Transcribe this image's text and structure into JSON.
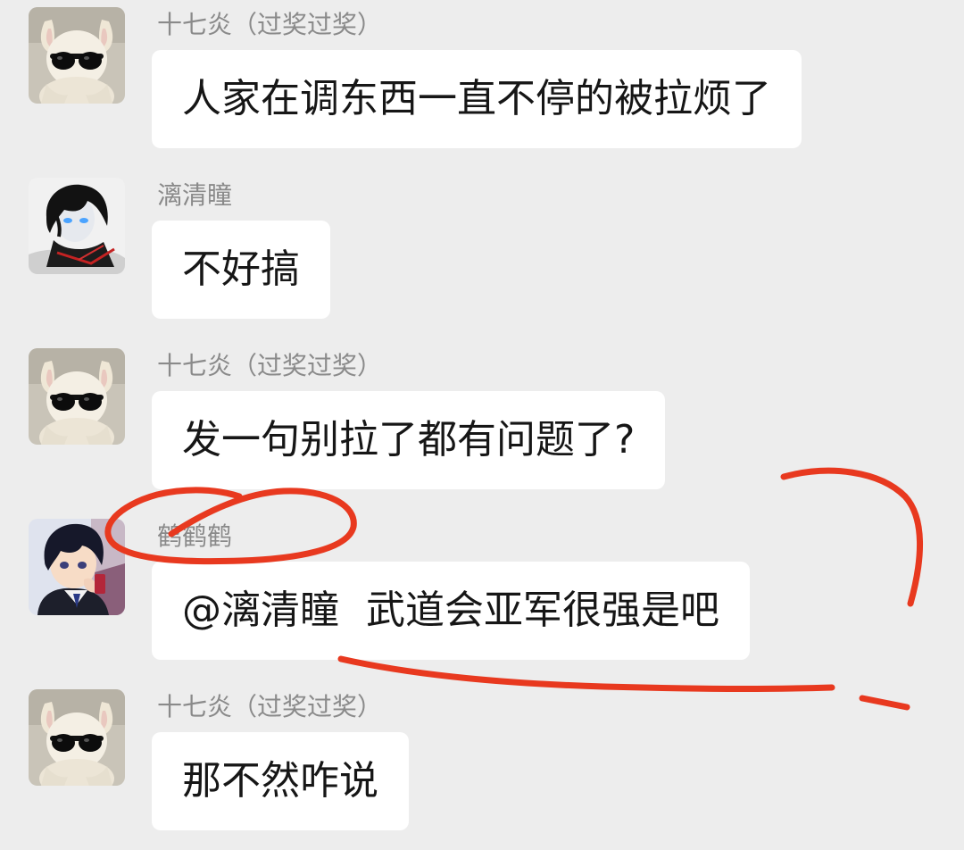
{
  "messages": [
    {
      "sender": "十七炎（过奖过奖）",
      "text": "人家在调东西一直不停的被拉烦了",
      "avatar_icon": "bunny-sunglasses-avatar-icon"
    },
    {
      "sender": "漓清瞳",
      "text": "不好搞",
      "avatar_icon": "anime-boy-dark-hair-avatar-icon"
    },
    {
      "sender": "十七炎（过奖过奖）",
      "text": "发一句别拉了都有问题了?",
      "avatar_icon": "bunny-sunglasses-avatar-icon"
    },
    {
      "sender": "鹤鹤鹤",
      "mention": "@漓清瞳",
      "text": "武道会亚军很强是吧",
      "avatar_icon": "anime-detective-boy-avatar-icon"
    },
    {
      "sender": "十七炎（过奖过奖）",
      "text": "那不然咋说",
      "avatar_icon": "bunny-sunglasses-avatar-icon"
    }
  ],
  "colors": {
    "background": "#ededed",
    "bubble": "#ffffff",
    "sender_name": "#8a8a8a",
    "message_text": "#161616",
    "annotation_red": "#e8391f"
  }
}
